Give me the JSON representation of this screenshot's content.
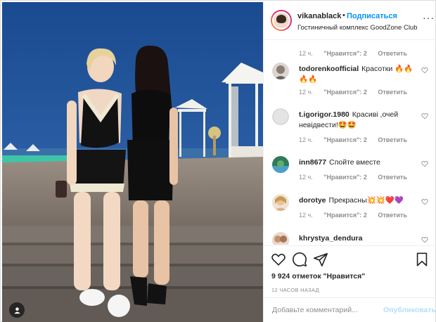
{
  "post": {
    "username": "vikanablack",
    "separator": "•",
    "follow_label": "Подписаться",
    "location": "Гостиничный комплекс GoodZone Club",
    "more_label": "···"
  },
  "first_meta": {
    "time": "12 ч.",
    "likes": "\"Нравится\": 2",
    "reply": "Ответить"
  },
  "comments": [
    {
      "user": "todorenkoofficial",
      "text": "Красотки 🔥🔥 🔥🔥",
      "time": "12 ч.",
      "likes": "\"Нравится\": 2",
      "reply": "Ответить"
    },
    {
      "user": "t.igorigor.1980",
      "text": "Красиві ,очей невідвести!🤩🤩",
      "time": "12 ч.",
      "likes": "\"Нравится\": 2",
      "reply": "Ответить"
    },
    {
      "user": "inn8677",
      "text": "Спойте вместе",
      "time": "12 ч.",
      "likes": "\"Нравится\": 2",
      "reply": "Ответить"
    },
    {
      "user": "dorotye",
      "text": "Прекрасны💥💥❤️💜",
      "time": "12 ч.",
      "likes": "\"Нравится\": 2",
      "reply": "Ответить"
    },
    {
      "user": "khrystya_dendura",
      "text": "",
      "time": "",
      "likes": "",
      "reply": ""
    }
  ],
  "likes_count": "9 924 отметок \"Нравится\"",
  "posted_time": "12 ЧАСОВ НАЗАД",
  "add_comment": {
    "placeholder": "Добавьте комментарий...",
    "publish_label": "Опубликовать"
  },
  "icons": {
    "like": "heart-icon",
    "comment": "comment-icon",
    "share": "paper-plane-icon",
    "save": "bookmark-icon",
    "tag": "user-tag-icon"
  },
  "colors": {
    "accent": "#0095f6",
    "publish_disabled": "#b2dffc",
    "muted": "#8e8e8e",
    "sky": "#1c4f95"
  }
}
